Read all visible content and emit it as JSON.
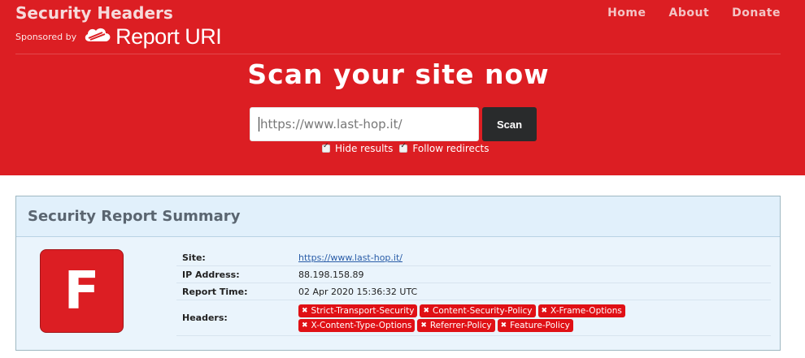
{
  "brand": {
    "title": "Security Headers",
    "sponsor_label": "Sponsored by",
    "sponsor_name": "Report URI"
  },
  "nav": {
    "home": "Home",
    "about": "About",
    "donate": "Donate"
  },
  "hero": {
    "heading": "Scan your site now",
    "url_value": "https://www.last-hop.it/",
    "scan_label": "Scan",
    "option_hide": "Hide results",
    "option_follow": "Follow redirects",
    "option_hide_checked": true,
    "option_follow_checked": true
  },
  "report": {
    "title": "Security Report Summary",
    "grade": "F",
    "site_label": "Site:",
    "site_value": "https://www.last-hop.it/",
    "ip_label": "IP Address:",
    "ip_value": "88.198.158.89",
    "time_label": "Report Time:",
    "time_value": "02 Apr 2020 15:36:32 UTC",
    "headers_label": "Headers:",
    "headers": [
      "Strict-Transport-Security",
      "Content-Security-Policy",
      "X-Frame-Options",
      "X-Content-Type-Options",
      "Referrer-Policy",
      "Feature-Policy"
    ],
    "missing_icon": "✖"
  },
  "colors": {
    "brand_red": "#dc1e23",
    "badge_red": "#e01015",
    "panel_blue": "#e1f0fb"
  }
}
